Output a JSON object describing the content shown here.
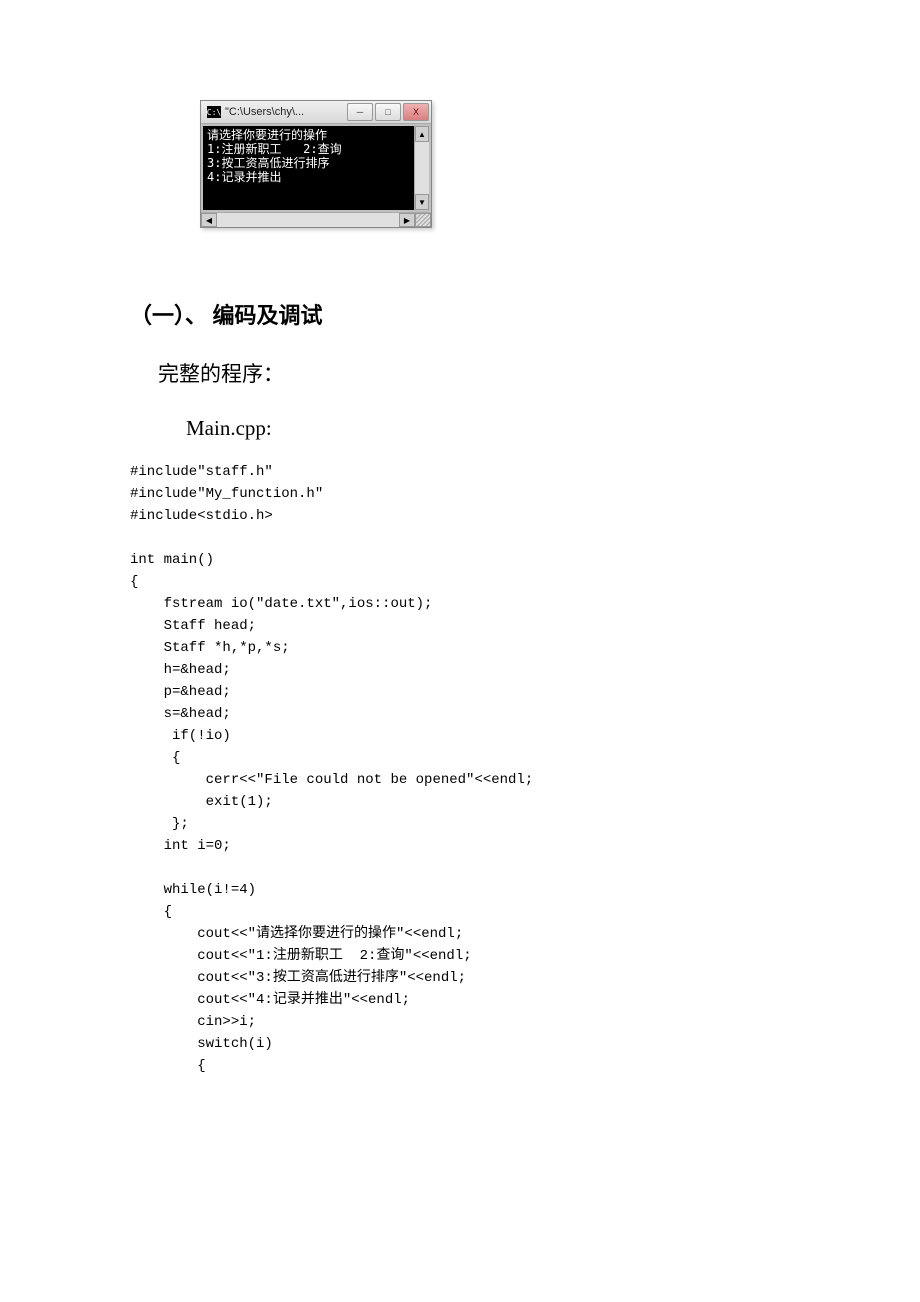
{
  "console": {
    "title": "\"C:\\Users\\chy\\...",
    "icon_label": "C:\\",
    "lines": [
      "请选择你要进行的操作",
      "1:注册新职工   2:查询",
      "3:按工资高低进行排序",
      "4:记录并推出"
    ],
    "buttons": {
      "minimize": "─",
      "maximize": "□",
      "close": "X"
    },
    "scroll": {
      "up": "▲",
      "down": "▼",
      "left": "◀",
      "right": "▶"
    }
  },
  "section": {
    "heading": "（一）、 编码及调试",
    "subtitle": "完整的程序：",
    "filename": "Main.cpp:"
  },
  "code": "#include\"staff.h\"\n#include\"My_function.h\"\n#include<stdio.h>\n\nint main()\n{\n    fstream io(\"date.txt\",ios::out);\n    Staff head;\n    Staff *h,*p,*s;\n    h=&head;\n    p=&head;\n    s=&head;\n     if(!io)\n     {\n         cerr<<\"File could not be opened\"<<endl;\n         exit(1);\n     };\n    int i=0;\n\n    while(i!=4)\n    {\n        cout<<\"请选择你要进行的操作\"<<endl;\n        cout<<\"1:注册新职工  2:查询\"<<endl;\n        cout<<\"3:按工资高低进行排序\"<<endl;\n        cout<<\"4:记录并推出\"<<endl;\n        cin>>i;\n        switch(i)\n        {"
}
